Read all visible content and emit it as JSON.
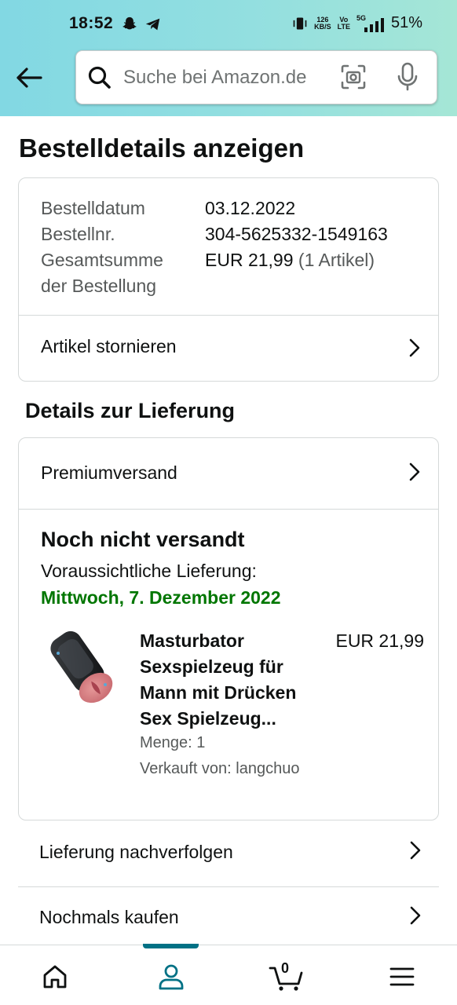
{
  "status_bar": {
    "time": "18:52",
    "network_speed_top": "126",
    "network_speed_bottom": "KB/S",
    "volte_top": "Vo",
    "volte_bottom": "LTE",
    "signal": "5G",
    "battery": "51%"
  },
  "header": {
    "search_placeholder": "Suche bei Amazon.de",
    "icons": [
      "back-arrow-icon",
      "search-icon",
      "camera-icon",
      "mic-icon"
    ]
  },
  "page": {
    "title": "Bestelldetails anzeigen"
  },
  "summary": {
    "order_date_label": "Bestelldatum",
    "order_date_value": "03.12.2022",
    "order_number_label": "Bestellnr.",
    "order_number_value": "304-5625332-1549163",
    "total_label_line1": "Gesamtsumme",
    "total_label_line2": "der Bestellung",
    "total_value": "EUR 21,99",
    "total_items": "(1 Artikel)",
    "cancel_link": "Artikel stornieren"
  },
  "delivery": {
    "section_title": "Details zur Lieferung",
    "shipping_method": "Premiumversand",
    "status": "Noch nicht versandt",
    "expected_label": "Voraussichtliche Lieferung:",
    "expected_date": "Mittwoch, 7. Dezember 2022",
    "expected_date_color": "#007600",
    "product": {
      "title": "Masturbator Sexspielzeug für Mann mit Drücken Sex Spielzeug...",
      "price": "EUR 21,99",
      "quantity": "Menge: 1",
      "seller": "Verkauft von: langchuo"
    }
  },
  "actions": {
    "track": "Lieferung nachverfolgen",
    "buy_again": "Nochmals kaufen"
  },
  "bottom_nav": {
    "items": [
      "home-icon",
      "account-icon",
      "cart-icon",
      "menu-icon"
    ],
    "cart_count": "0",
    "active": "account",
    "accent_color": "#007185"
  }
}
